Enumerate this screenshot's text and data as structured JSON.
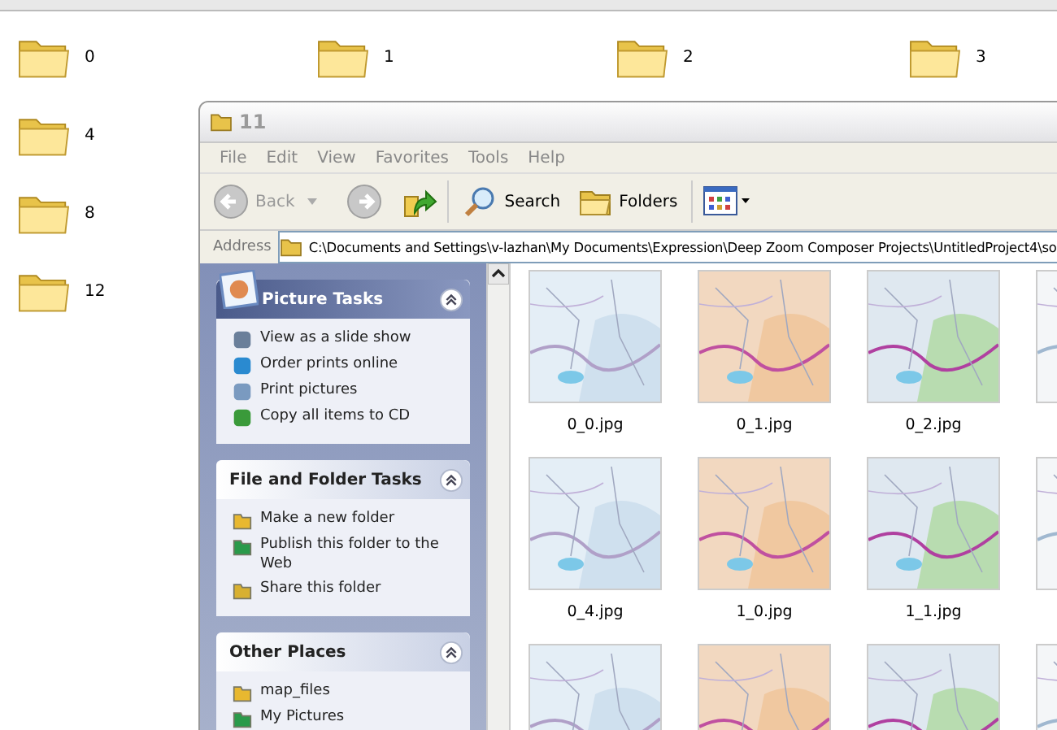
{
  "top_folders": [
    {
      "label": "0"
    },
    {
      "label": "1"
    },
    {
      "label": "2"
    },
    {
      "label": "3"
    }
  ],
  "left_folders": [
    {
      "label": "4"
    },
    {
      "label": "8"
    },
    {
      "label": "12"
    }
  ],
  "window": {
    "title": "11",
    "menu": [
      "File",
      "Edit",
      "View",
      "Favorites",
      "Tools",
      "Help"
    ],
    "toolbar": {
      "back": "Back",
      "search": "Search",
      "folders": "Folders"
    },
    "address": {
      "label": "Address",
      "path": "C:\\Documents and Settings\\v-lazhan\\My Documents\\Expression\\Deep Zoom Composer Projects\\UntitledProject4\\so"
    },
    "panels": [
      {
        "kind": "picture",
        "title": "Picture Tasks",
        "expanded": true,
        "items": [
          "View as a slide show",
          "Order prints online",
          "Print pictures",
          "Copy all items to CD"
        ]
      },
      {
        "kind": "plain",
        "title": "File and Folder Tasks",
        "expanded": true,
        "items": [
          "Make a new folder",
          "Publish this folder to the Web",
          "Share this folder"
        ]
      },
      {
        "kind": "plain",
        "title": "Other Places",
        "expanded": true,
        "items": [
          "map_files",
          "My Pictures"
        ]
      }
    ],
    "thumbnails": [
      {
        "kind": "picture",
        "name": "0_0.jpg"
      },
      {
        "kind": "picture",
        "name": "0_1.jpg"
      },
      {
        "kind": "picture",
        "name": "0_2.jpg"
      },
      {
        "kind": "picture"
      },
      {
        "kind": "picture",
        "name": "0_4.jpg"
      },
      {
        "kind": "picture",
        "name": "1_0.jpg"
      },
      {
        "kind": "picture",
        "name": "1_1.jpg"
      },
      {
        "kind": "picture"
      },
      {
        "kind": "picture"
      },
      {
        "kind": "picture"
      },
      {
        "kind": "picture"
      },
      {
        "kind": "picture"
      }
    ]
  }
}
